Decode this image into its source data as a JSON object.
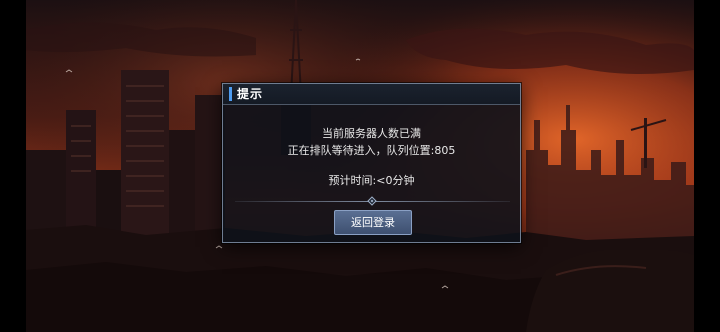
{
  "dialog": {
    "title": "提示",
    "message_line1": "当前服务器人数已满",
    "message_line2": "正在排队等待进入，队列位置:805",
    "wait_time": "预计时间:<0分钟",
    "return_button_label": "返回登录"
  },
  "queue": {
    "position": 805
  },
  "colors": {
    "sky_top": "#1a0e10",
    "sky_glow": "#c1441d",
    "accent_blue": "#4f9cf0",
    "button": "#4a5d80"
  }
}
